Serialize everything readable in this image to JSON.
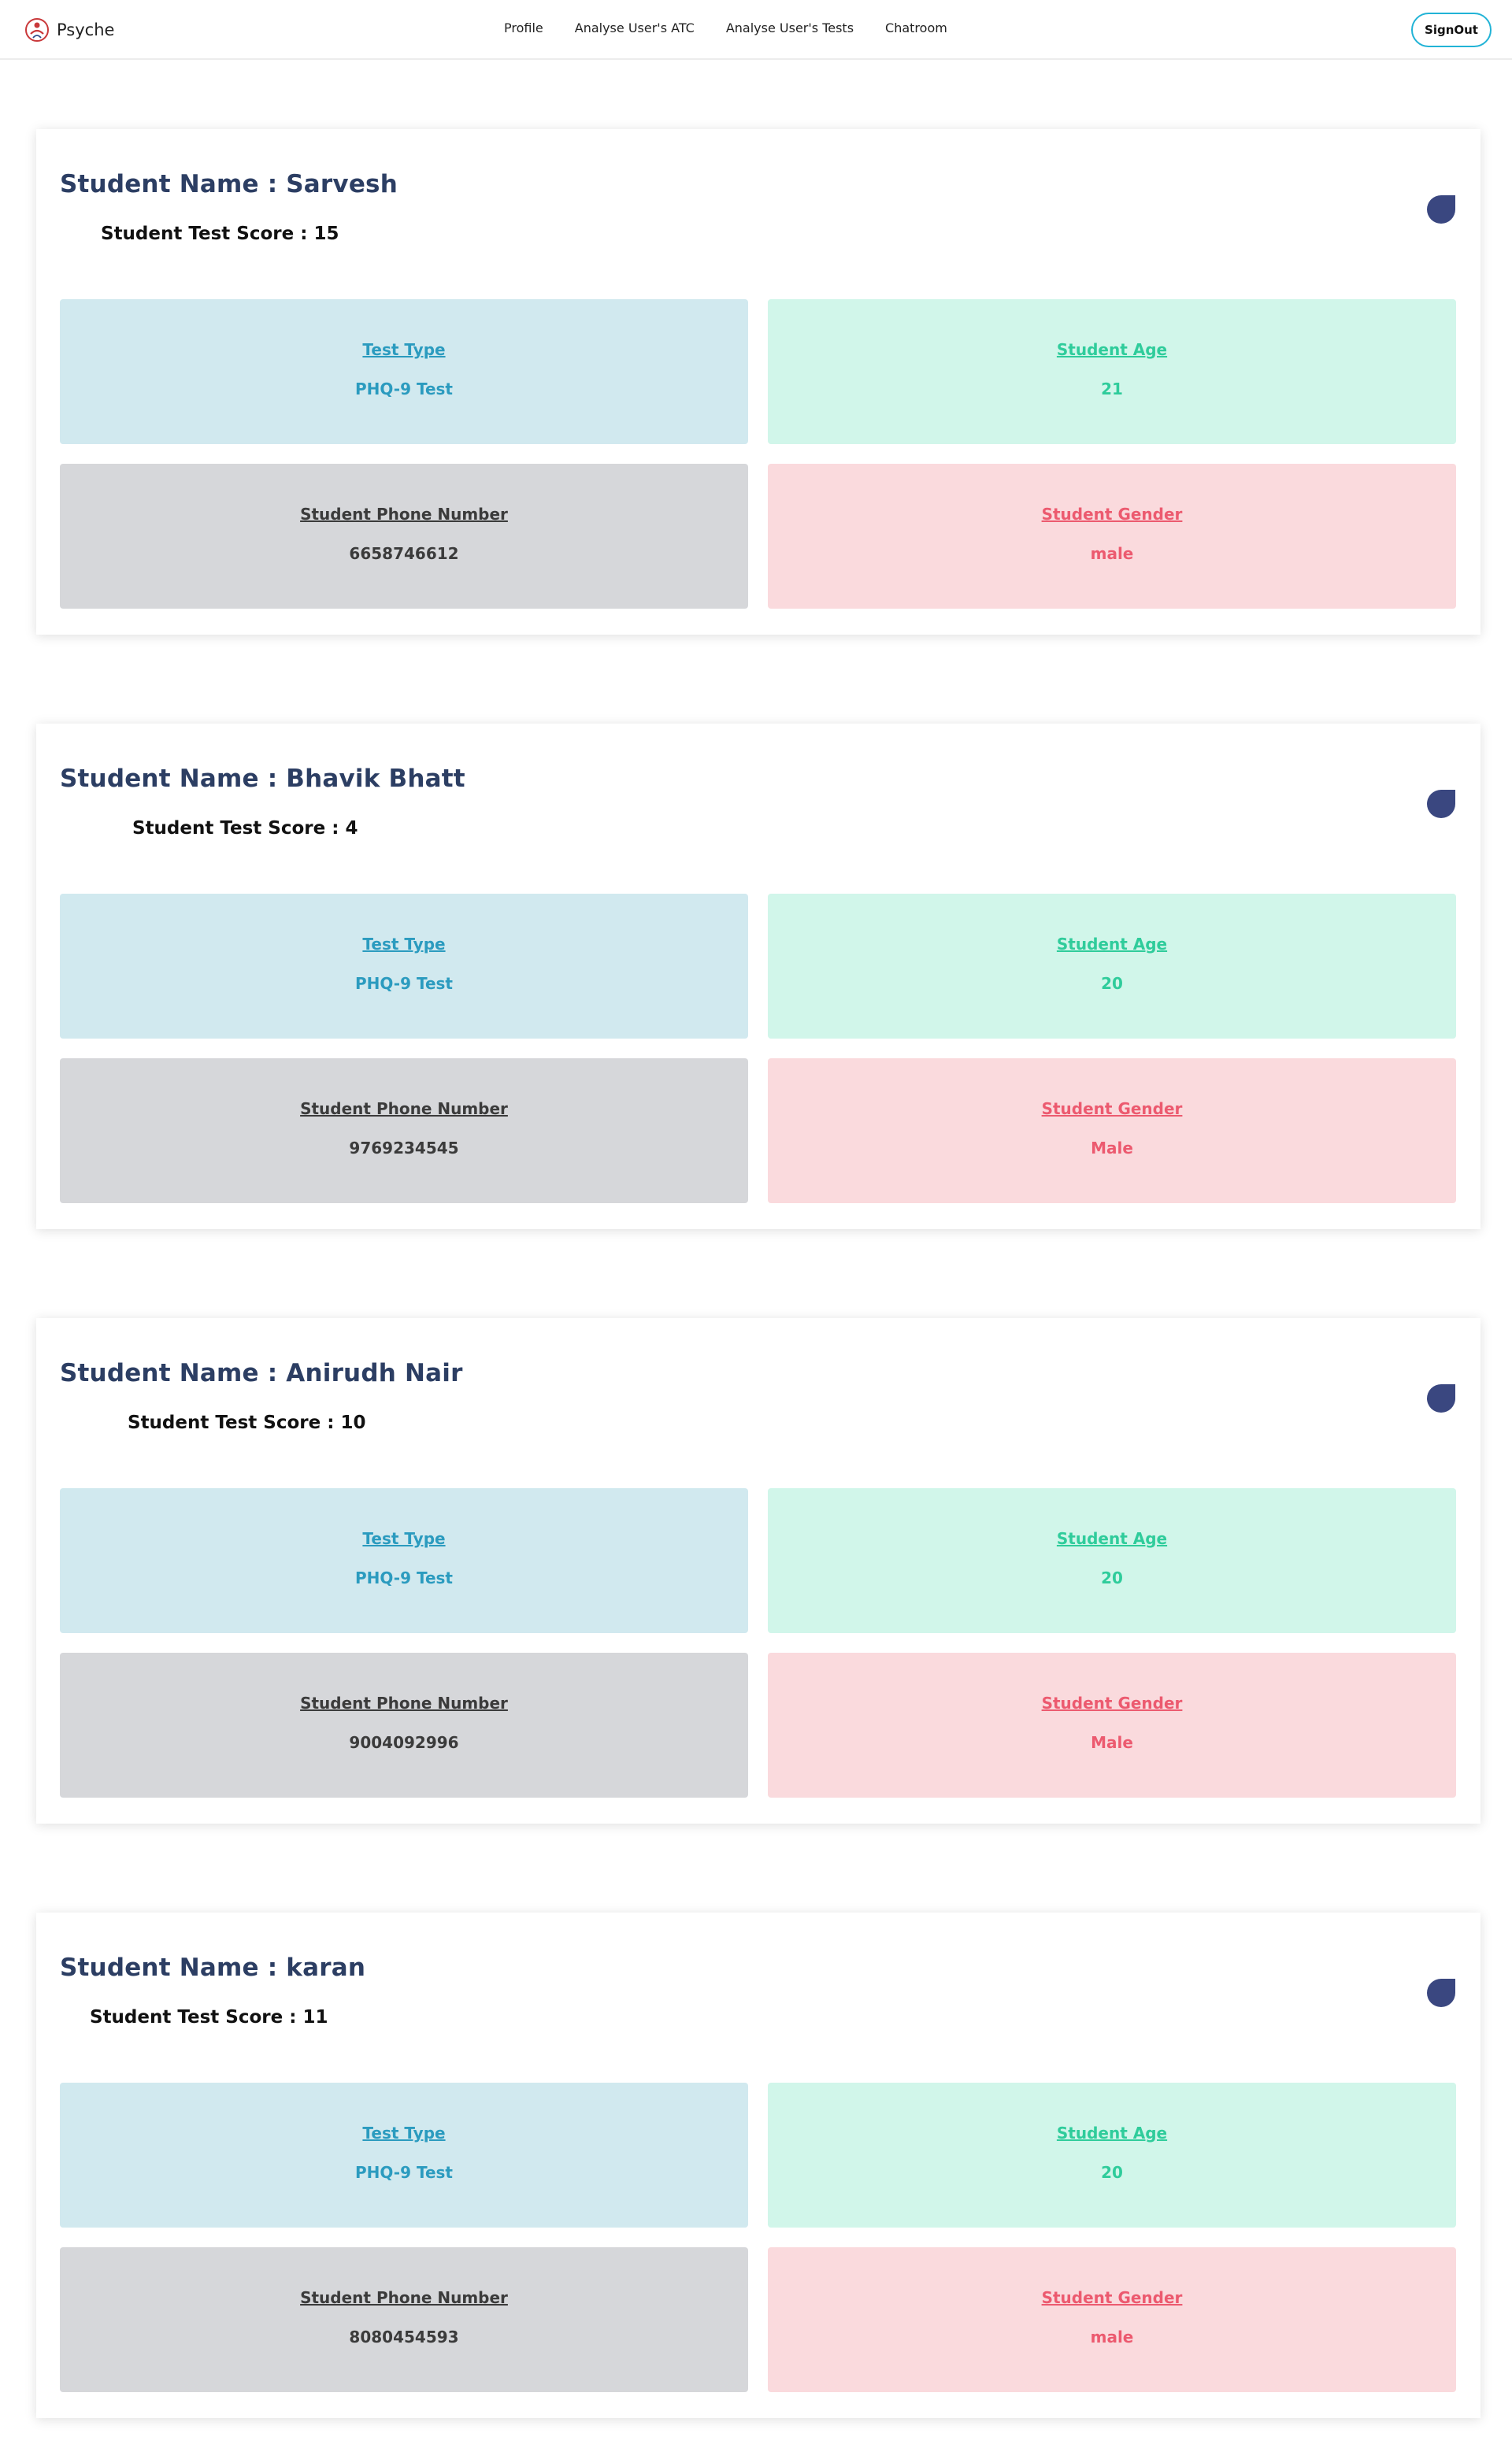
{
  "navbar": {
    "brand": "Psyche",
    "links": [
      "Profile",
      "Analyse User's ATC",
      "Analyse User's Tests",
      "Chatroom"
    ],
    "signout": "SignOut"
  },
  "cards": [
    {
      "name": "Student Name : Sarvesh",
      "score": "Student Test Score : 15",
      "test_type_label": "Test Type",
      "test_type": "PHQ-9 Test",
      "age_label": "Student Age",
      "age": "21",
      "phone_label": "Student Phone Number",
      "phone": "6658746612",
      "gender_label": "Student Gender",
      "gender": "male"
    },
    {
      "name": "Student Name : Bhavik Bhatt",
      "score": "Student Test Score : 4",
      "test_type_label": "Test Type",
      "test_type": "PHQ-9 Test",
      "age_label": "Student Age",
      "age": "20",
      "phone_label": "Student Phone Number",
      "phone": "9769234545",
      "gender_label": "Student Gender",
      "gender": "Male"
    },
    {
      "name": "Student Name : Anirudh Nair",
      "score": "Student Test Score : 10",
      "test_type_label": "Test Type",
      "test_type": "PHQ-9 Test",
      "age_label": "Student Age",
      "age": "20",
      "phone_label": "Student Phone Number",
      "phone": "9004092996",
      "gender_label": "Student Gender",
      "gender": "Male"
    },
    {
      "name": "Student Name : karan",
      "score": "Student Test Score : 11",
      "test_type_label": "Test Type",
      "test_type": "PHQ-9 Test",
      "age_label": "Student Age",
      "age": "20",
      "phone_label": "Student Phone Number",
      "phone": "8080454593",
      "gender_label": "Student Gender",
      "gender": "male"
    }
  ],
  "colors": {
    "title": "#2c3e63",
    "test_type": "#2b9bbf",
    "age": "#2fcc9b",
    "phone": "#3b3b3b",
    "gender": "#ec5a6f",
    "signout_border": "#21b3d6",
    "icon": "#3a4780"
  },
  "icons": {
    "brand": "psyche-logo-icon",
    "card_badge": "drop-icon"
  }
}
